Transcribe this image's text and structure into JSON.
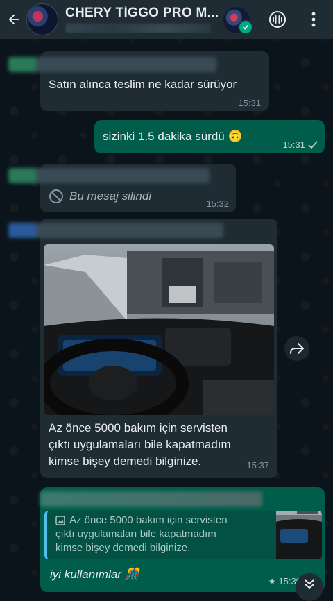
{
  "header": {
    "title": "CHERY TİGGO PRO M...",
    "back_icon": "arrow-left-icon",
    "call_icon": "audio-wave-icon",
    "menu_icon": "more-vertical-icon"
  },
  "messages": [
    {
      "type": "in",
      "text": "Satın alınca teslim ne kadar sürüyor",
      "time": "15:31"
    },
    {
      "type": "out",
      "text": "sizinki 1.5 dakika sürdü 🙃",
      "time": "15:31"
    },
    {
      "type": "in",
      "deleted": true,
      "text": "Bu mesaj silindi",
      "time": "15:32"
    },
    {
      "type": "in",
      "image": true,
      "lines": [
        "Az önce 5000 bakım için servisten",
        "çıktı uygulamaları bile kapatmadım",
        "kimse bişey demedi bilginize."
      ],
      "time": "15:37"
    },
    {
      "type": "out",
      "quote_lines": [
        "Az önce 5000 bakım için servisten",
        "çıktı uygulamaları bile kapatmadım",
        "kimse bişey demedi bilginize."
      ],
      "text": "iyi kullanımlar 🎊",
      "time": "15:39"
    }
  ],
  "colors": {
    "incoming": "#1f2c34",
    "outgoing": "#005c4b",
    "header": "#1f2c34",
    "accent": "#00a884"
  }
}
